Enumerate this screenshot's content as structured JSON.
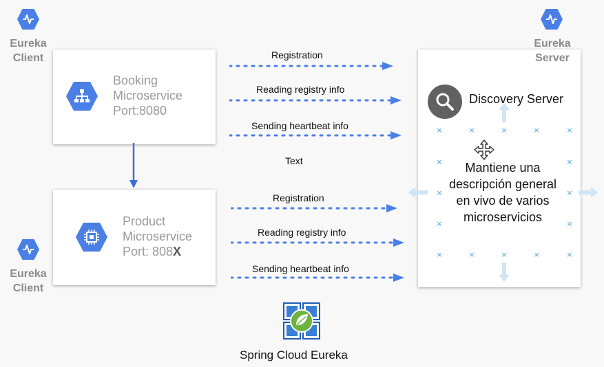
{
  "client_label_top": [
    "Eureka",
    "Client"
  ],
  "client_label_bottom": [
    "Eureka",
    "Client"
  ],
  "server_label": [
    "Eureka",
    "Server"
  ],
  "booking": {
    "name": "Booking",
    "type": "Microservice",
    "port": "Port:8080"
  },
  "product": {
    "name": "Product",
    "type": "Microservice",
    "port_prefix": "Port: 808",
    "port_suffix": "X"
  },
  "arrows_top": [
    "Registration",
    "Reading registry info",
    "Sending heartbeat info"
  ],
  "arrows_bottom": [
    "Registration",
    "Reading registry info",
    "Sending heartbeat info"
  ],
  "middle_text": "Text",
  "server": {
    "title": "Discovery Server",
    "description": [
      "Mantiene una",
      "descripción general",
      "en vivo de varios",
      "microservicios"
    ]
  },
  "caption": "Spring Cloud Eureka",
  "icons": {
    "eureka": "eureka-pulse-icon",
    "booking": "network-hierarchy-icon",
    "product": "chip-icon",
    "search": "search-icon",
    "move": "move-cursor-icon",
    "spring": "spring-leaf-icon"
  },
  "colors": {
    "blue": "#4a7fe6",
    "arrow": "#3d6fd9",
    "gray_text": "#8a8a8a",
    "handle": "#cfe4f5"
  }
}
